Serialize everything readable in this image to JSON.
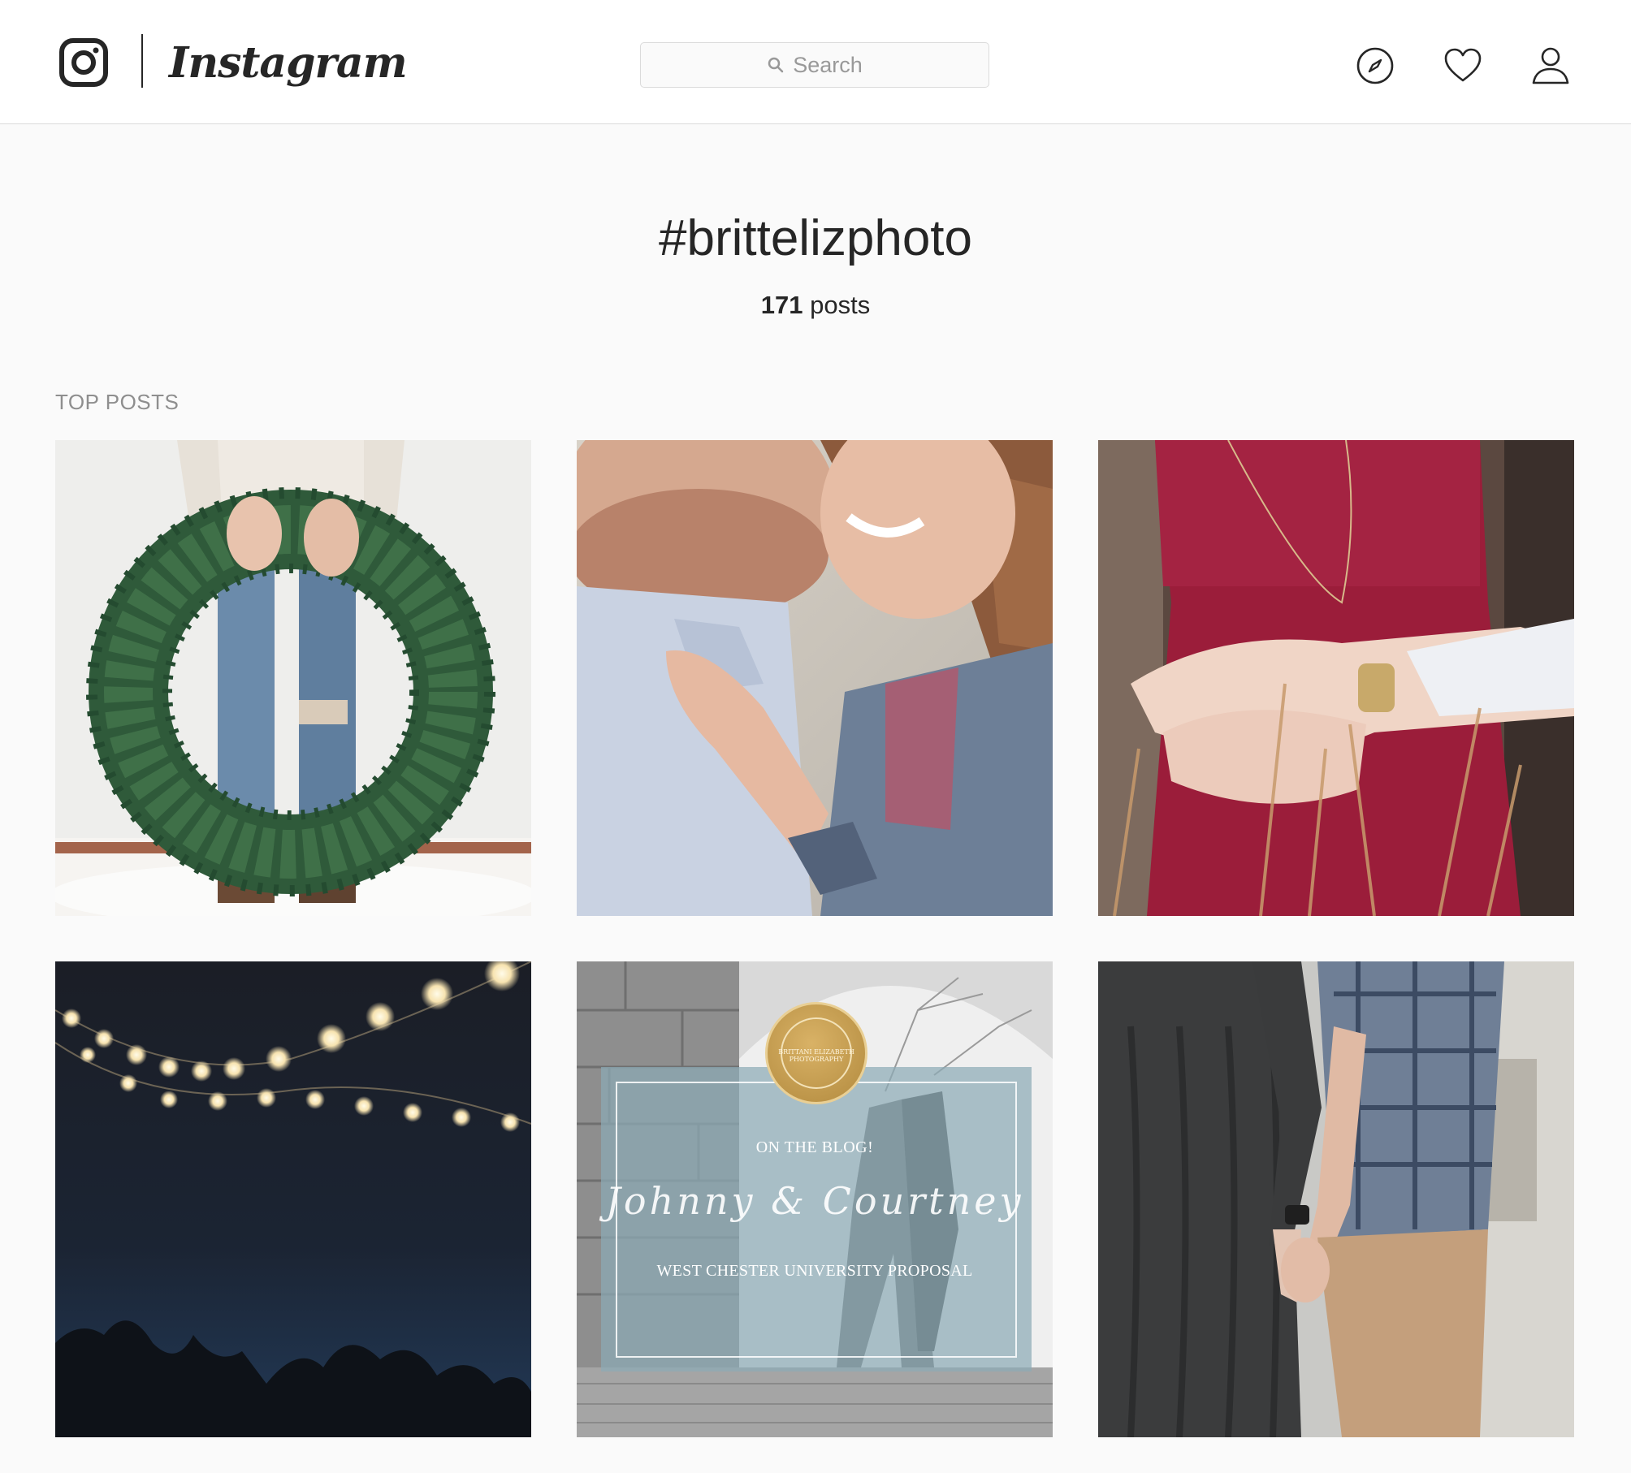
{
  "header": {
    "logo_icon": "instagram-camera-icon",
    "wordmark": "Instagram",
    "search": {
      "icon": "search-icon",
      "placeholder": "Search"
    },
    "nav_icons": [
      "compass-icon",
      "heart-icon",
      "person-icon"
    ]
  },
  "hashtag": {
    "title": "#brittelizphoto",
    "count": "171",
    "count_suffix": " posts"
  },
  "section": {
    "label": "TOP POSTS"
  },
  "posts": [
    {
      "alt": "wreath-photo"
    },
    {
      "alt": "couple-forehead-photo"
    },
    {
      "alt": "red-dress-hug-photo"
    },
    {
      "alt": "string-lights-photo"
    },
    {
      "alt": "blog-announcement-photo",
      "badge_text": "BRITTANI ELIZABETH PHOTOGRAPHY",
      "line1": "ON THE BLOG!",
      "line2": "Johnny & Courtney",
      "line3": "WEST CHESTER UNIVERSITY PROPOSAL"
    },
    {
      "alt": "holding-hands-photo"
    }
  ],
  "colors": {
    "border": "#dbdbdb",
    "text": "#262626",
    "muted": "#8e8e8e",
    "background": "#fafafa"
  }
}
